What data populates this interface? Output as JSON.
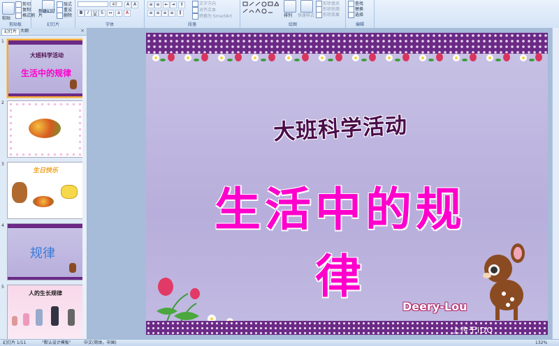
{
  "ribbon": {
    "clipboard": {
      "label": "剪贴板",
      "paste": "粘贴",
      "cut": "剪切",
      "copy": "复制",
      "format_painter": "格式刷"
    },
    "slides": {
      "label": "幻灯片",
      "new_slide": "新建幻灯片",
      "layout": "版式",
      "reset": "重设",
      "delete": "删除"
    },
    "font": {
      "label": "字体",
      "font_name": "",
      "font_size": "40"
    },
    "paragraph": {
      "label": "段落",
      "text_direction": "文字方向",
      "align_text": "对齐文本",
      "convert_smartart": "转换为 SmartArt"
    },
    "drawing": {
      "label": "绘图",
      "arrange": "排列",
      "quick_styles": "快速样式",
      "shape_fill": "形状填充",
      "shape_outline": "形状轮廓",
      "shape_effects": "形状效果"
    },
    "editing": {
      "label": "编辑",
      "find": "查找",
      "replace": "替换",
      "select": "选择"
    }
  },
  "pane": {
    "tab_slides": "幻灯片",
    "tab_outline": "大纲",
    "close": "×",
    "thumbnails": [
      {
        "number": "1",
        "title": "大班科学活动",
        "subtitle": "生活中的规律"
      },
      {
        "number": "2"
      },
      {
        "number": "3",
        "title": "生日快乐"
      },
      {
        "number": "4",
        "title": "规律"
      },
      {
        "number": "5",
        "title": "人的生长规律"
      }
    ]
  },
  "slide": {
    "subtitle": "大班科学活动",
    "title": "生活中的规律",
    "brand": "Deery-Lou",
    "watermark": "上传于iDO 3MT.COM.CN"
  },
  "statusbar": {
    "slide_counter": "幻灯片 1/11",
    "theme": "\"默认设计模板\"",
    "language": "中文(简体，中国)",
    "zoom": "132%"
  },
  "colors": {
    "title": "#ff00cc",
    "subtitle": "#4a0d4a",
    "band": "#6b2a86",
    "slide_bg": "#c9c3e6",
    "selection": "#f2a83a"
  }
}
